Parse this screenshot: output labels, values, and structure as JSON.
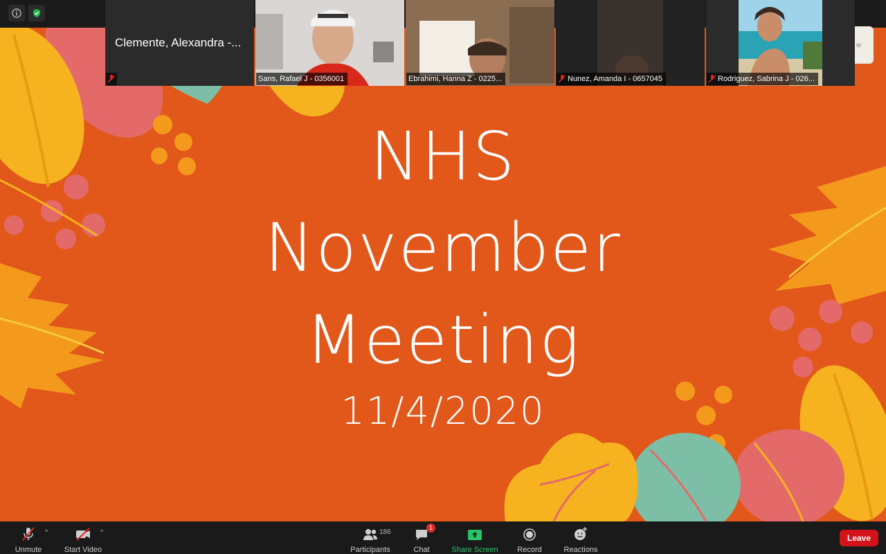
{
  "slide": {
    "line1": "NHS",
    "line2": "November",
    "line3": "Meeting",
    "date": "11/4/2020",
    "colors": {
      "background": "#e2571a",
      "text": "#ffffff"
    }
  },
  "participants_strip": [
    {
      "name": "Clemente, Alexandra -...",
      "muted": true,
      "video": false,
      "active": false
    },
    {
      "name": "Sans, Rafael J - 0356001",
      "muted": false,
      "video": true,
      "active": false
    },
    {
      "name": "Ebrahimi, Hanna Z - 0225...",
      "muted": false,
      "video": true,
      "active": true
    },
    {
      "name": "Nunez, Amanda I - 0657045",
      "muted": true,
      "video": true,
      "active": false
    },
    {
      "name": "Rodriguez, Sabrina J - 026...",
      "muted": true,
      "video": true,
      "active": false
    }
  ],
  "side_tab": {
    "text": "w"
  },
  "toolbar": {
    "unmute": "Unmute",
    "start_video": "Start Video",
    "participants": "Participants",
    "participants_count": "186",
    "chat": "Chat",
    "chat_badge": "1",
    "share_screen": "Share Screen",
    "record": "Record",
    "reactions": "Reactions",
    "leave": "Leave"
  },
  "icons": [
    "info-icon",
    "shield-check-icon",
    "microphone-muted-icon",
    "video-camera-off-icon",
    "participants-icon",
    "chat-icon",
    "share-screen-icon",
    "record-icon",
    "reactions-icon"
  ],
  "accent_colors": {
    "share_green": "#29c36a",
    "leave_red": "#d4121a",
    "active_speaker": "#c8d84a"
  }
}
